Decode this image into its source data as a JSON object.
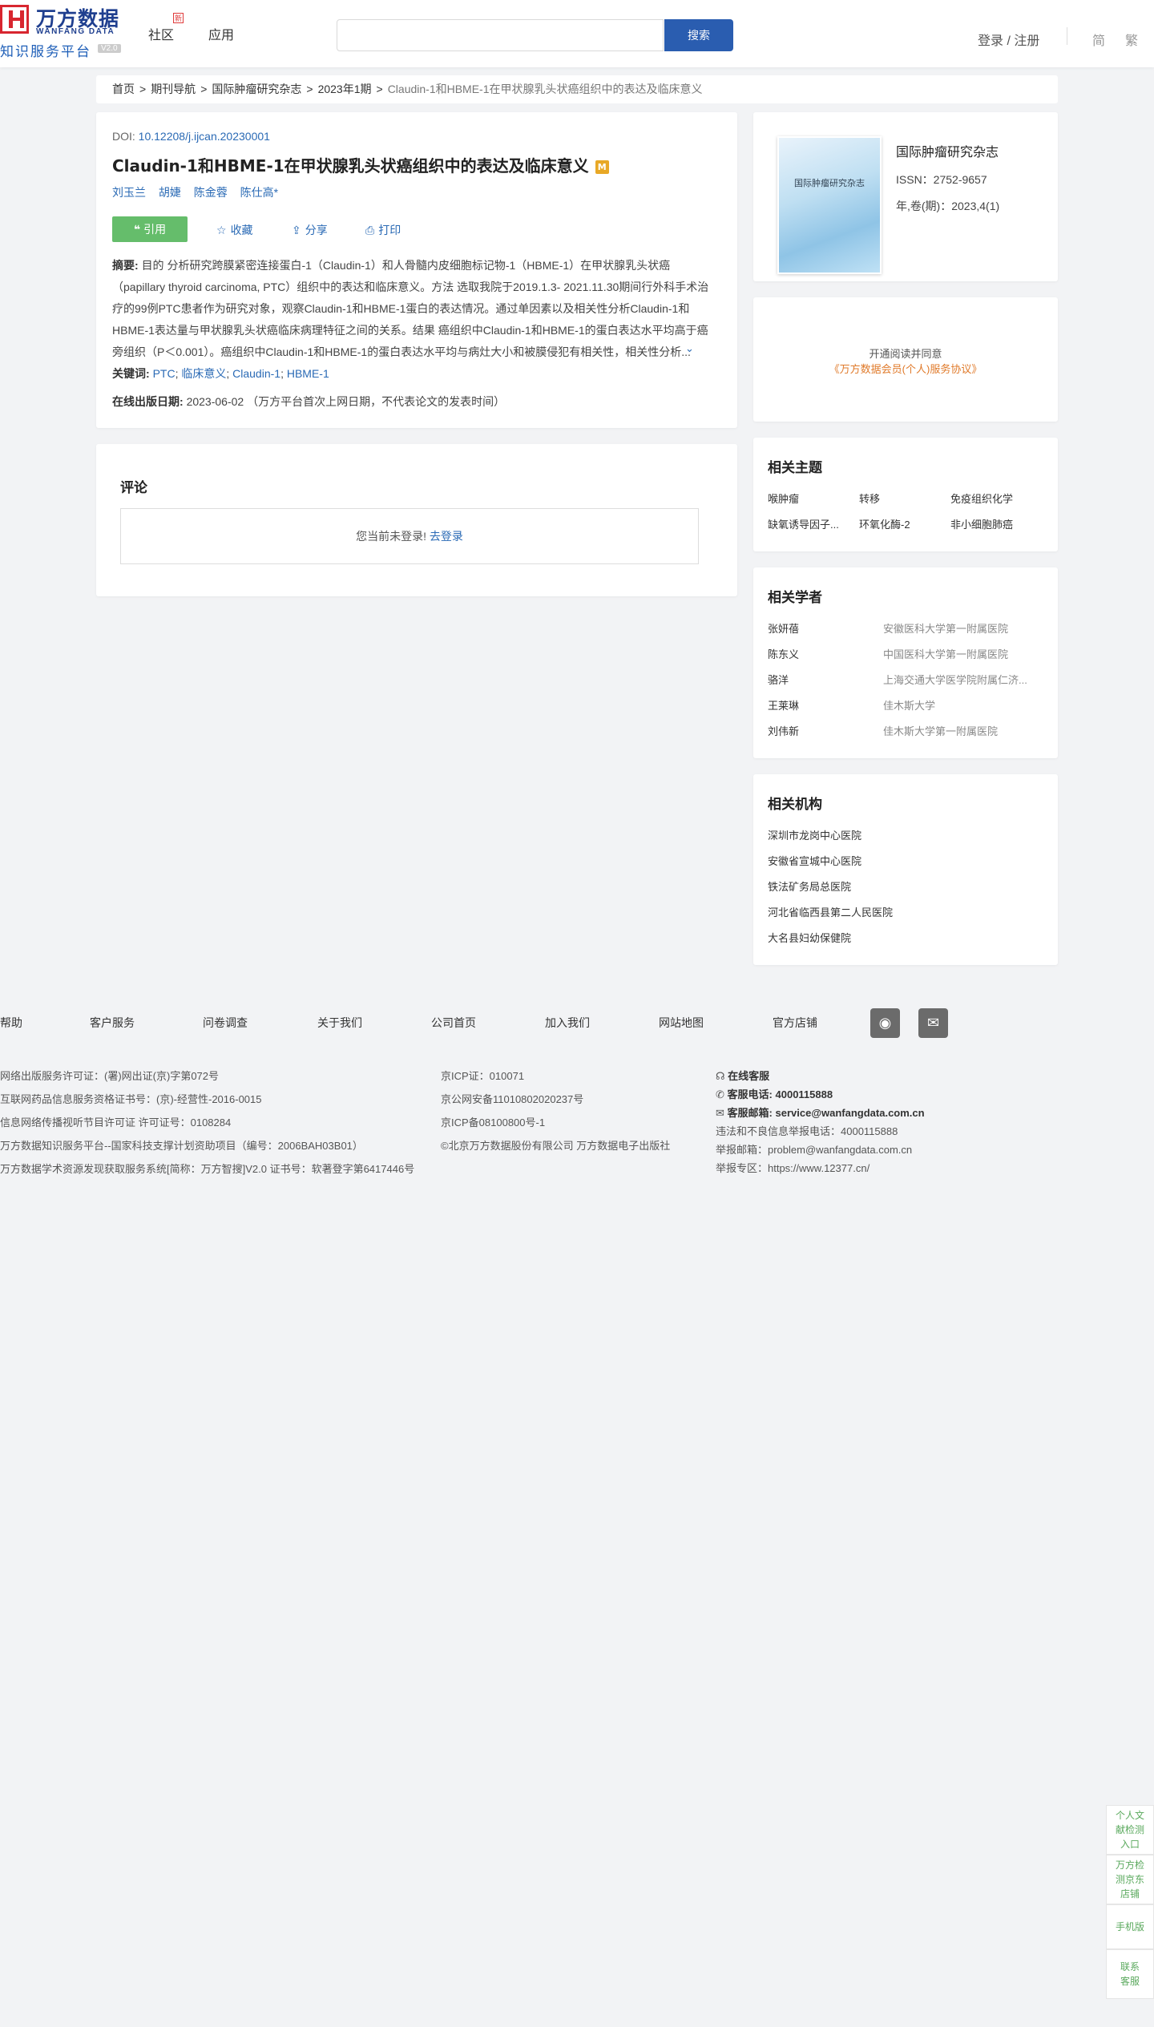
{
  "header": {
    "logo_cn": "万方数据",
    "logo_en": "WANFANG DATA",
    "platform": "知识服务平台",
    "version": "V2.0",
    "nav": [
      "社区",
      "应用"
    ],
    "community_badge": "新",
    "search_placeholder": "",
    "search_button": "搜索",
    "login": "登录 / 注册",
    "lang_simplified": "简",
    "lang_traditional": "繁"
  },
  "breadcrumb": {
    "items": [
      "首页",
      "期刊导航",
      "国际肿瘤研究杂志",
      "2023年1期"
    ],
    "current": "Claudin-1和HBME-1在甲状腺乳头状癌组织中的表达及临床意义",
    "separator": ">"
  },
  "article": {
    "doi_label": "DOI:",
    "doi": "10.12208/j.ijcan.20230001",
    "title": "Claudin-1和HBME-1在甲状腺乳头状癌组织中的表达及临床意义",
    "title_badge": "M",
    "authors": [
      "刘玉兰",
      "胡婕",
      "陈金蓉",
      "陈仕高*"
    ],
    "actions": {
      "cite": "引用",
      "favorite": "收藏",
      "share": "分享",
      "print": "打印"
    },
    "abstract_label": "摘要:",
    "abstract": "目的 分析研究跨膜紧密连接蛋白-1（Claudin-1）和人骨髓内皮细胞标记物-1（HBME-1）在甲状腺乳头状癌（papillary thyroid carcinoma, PTC）组织中的表达和临床意义。方法 选取我院于2019.1.3- 2021.11.30期间行外科手术治疗的99例PTC患者作为研究对象，观察Claudin-1和HBME-1蛋白的表达情况。通过单因素以及相关性分析Claudin-1和HBME-1表达量与甲状腺乳头状癌临床病理特征之间的关系。结果 癌组织中Claudin-1和HBME-1的蛋白表达水平均高于癌旁组织（P＜0.001）。癌组织中Claudin-1和HBME-1的蛋白表达水平均与病灶大小和被膜侵犯有相关性，相关性分析...",
    "keywords_label": "关键词:",
    "keywords": [
      "PTC",
      "临床意义",
      "Claudin-1",
      "HBME-1"
    ],
    "keywords_sep": "; ",
    "pub_date_label": "在线出版日期:",
    "pub_date": "2023-06-02",
    "pub_date_note": "（万方平台首次上网日期，不代表论文的发表时间）"
  },
  "comments": {
    "title": "评论",
    "not_logged": "您当前未登录!",
    "go_login": "去登录"
  },
  "journal": {
    "cover_title": "国际肿瘤研究杂志",
    "name": "国际肿瘤研究杂志",
    "issn": "ISSN：2752-9657",
    "volume": "年,卷(期)：2023,4(1)"
  },
  "subscribe": {
    "line1": "开通阅读并同意",
    "line2": "《万方数据会员(个人)服务协议》"
  },
  "related_topics": {
    "title": "相关主题",
    "items": [
      "喉肿瘤",
      "转移",
      "免疫组织化学",
      "缺氧诱导因子...",
      "环氧化酶-2",
      "非小细胞肺癌"
    ]
  },
  "related_scholars": {
    "title": "相关学者",
    "items": [
      {
        "name": "张妍蓓",
        "org": "安徽医科大学第一附属医院"
      },
      {
        "name": "陈东义",
        "org": "中国医科大学第一附属医院"
      },
      {
        "name": "骆洋",
        "org": "上海交通大学医学院附属仁济..."
      },
      {
        "name": "王莱琳",
        "org": "佳木斯大学"
      },
      {
        "name": "刘伟新",
        "org": "佳木斯大学第一附属医院"
      }
    ]
  },
  "related_orgs": {
    "title": "相关机构",
    "items": [
      "深圳市龙岗中心医院",
      "安徽省宣城中心医院",
      "铁法矿务局总医院",
      "河北省临西县第二人民医院",
      "大名县妇幼保健院"
    ]
  },
  "footer": {
    "nav": [
      "帮助",
      "客户服务",
      "问卷调查",
      "关于我们",
      "公司首页",
      "加入我们",
      "网站地图",
      "官方店铺"
    ],
    "col1": [
      "网络出版服务许可证：(署)网出证(京)字第072号",
      "互联网药品信息服务资格证书号：(京)-经营性-2016-0015",
      "信息网络传播视听节目许可证 许可证号：0108284",
      "万方数据知识服务平台--国家科技支撑计划资助项目（编号：2006BAH03B01）",
      "万方数据学术资源发现获取服务系统[简称：万方智搜]V2.0 证书号：软著登字第6417446号"
    ],
    "col2": [
      "京ICP证：010071",
      "京公网安备11010802020237号",
      "京ICP备08100800号-1",
      "©北京万方数据股份有限公司 万方数据电子出版社"
    ],
    "online_service": "在线客服",
    "phone_label": "客服电话:",
    "phone": "4000115888",
    "email_label": "客服邮箱:",
    "email": "service@wanfangdata.com.cn",
    "report_phone": "违法和不良信息举报电话：4000115888",
    "report_email": "举报邮箱：problem@wanfangdata.com.cn",
    "report_zone": "举报专区：https://www.12377.cn/"
  },
  "side_tabs": [
    "个人文献检测入口",
    "万方检测京东店铺",
    "手机版",
    "联系客服"
  ]
}
